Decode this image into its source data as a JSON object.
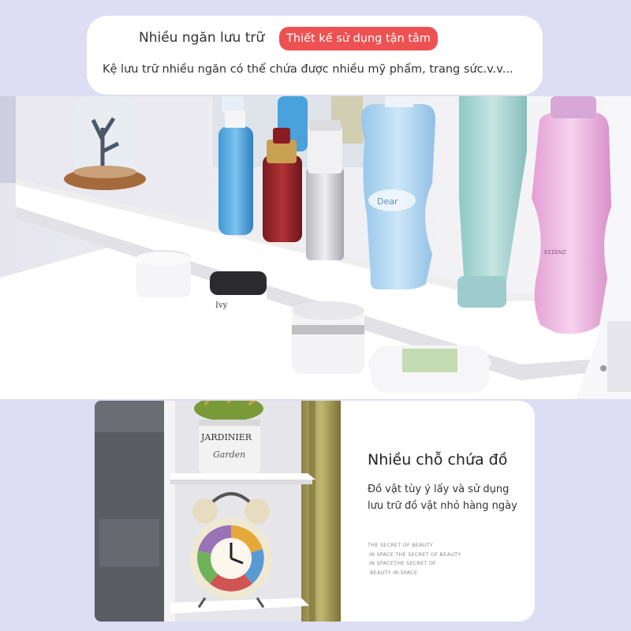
{
  "header": {
    "title": "Nhiều ngăn lưu trữ",
    "badge": "Thiết kế sử dụng tận tâm",
    "subtitle": "Kệ lưu trữ nhiều ngăn có thể chứa được nhiều mỹ phẩm, trang sức.v.v..."
  },
  "photos": {
    "shelf_label_1": "Dear",
    "shelf_label_2": "Clock",
    "pot_label_1": "JARDINIER",
    "pot_label_2": "Garden"
  },
  "info": {
    "title": "Nhiều chỗ chứa đồ",
    "desc_line1": "Đồ vật tùy ý lấy và sử dụng",
    "desc_line2": "lưu trữ đồ vật nhỏ hàng ngày",
    "fine_lines": [
      "THE SECRET OF BEAUTY",
      "IN SPACE THE SECRET OF BEAUTY",
      "IN SPACETHE SECRET OF",
      "BEAUTY IN SPACE"
    ]
  },
  "colors": {
    "page_bg": "#ddddf3",
    "badge_bg": "#ee5151",
    "card_bg": "#ffffff"
  }
}
